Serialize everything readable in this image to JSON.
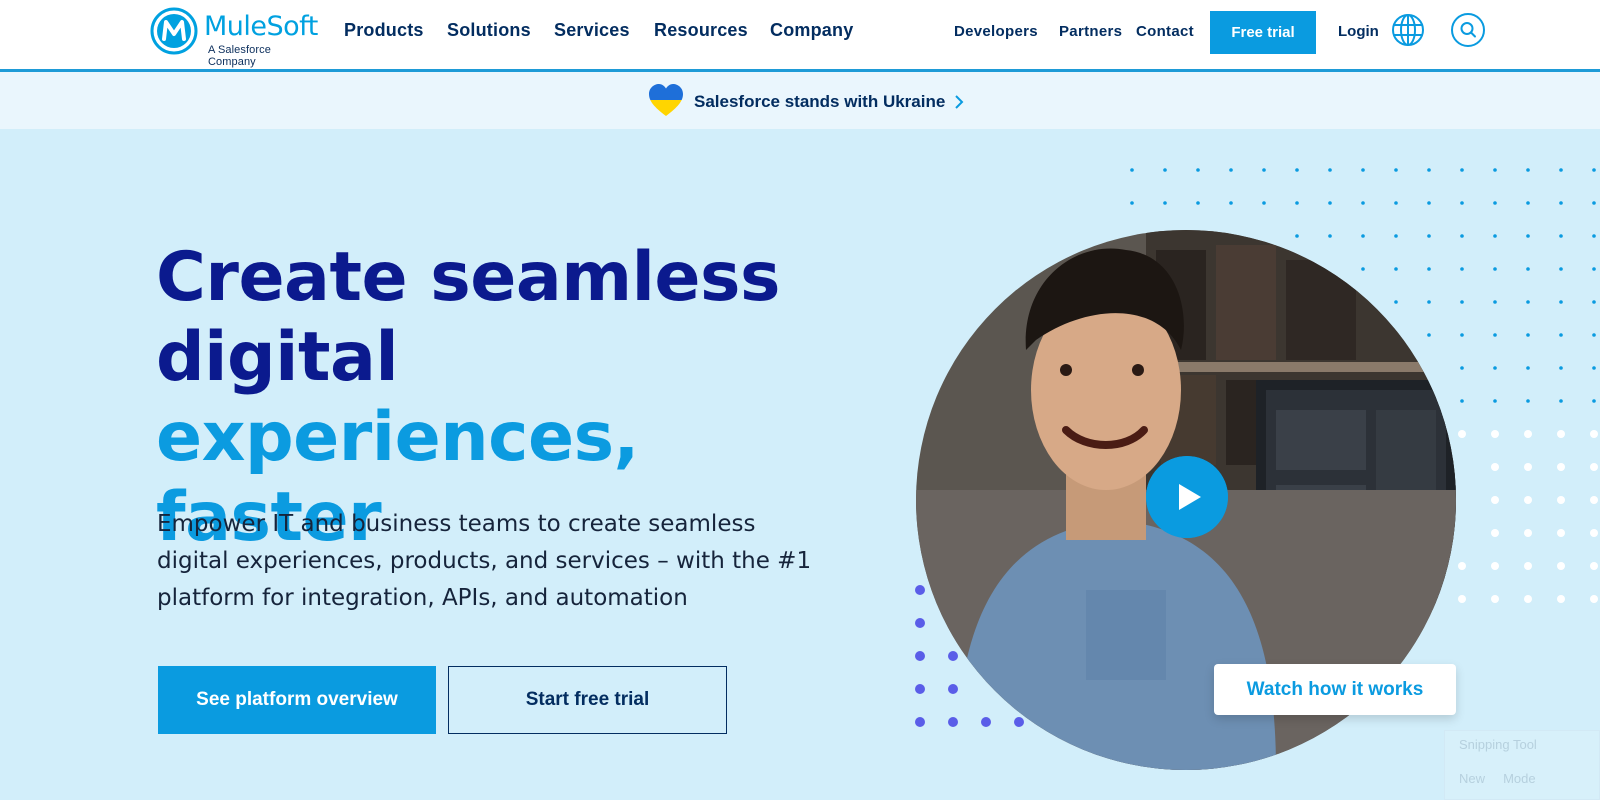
{
  "header": {
    "logo": {
      "name": "MuleSoft",
      "subtitle": "A Salesforce Company"
    },
    "nav_main": [
      "Products",
      "Solutions",
      "Services",
      "Resources",
      "Company"
    ],
    "nav_secondary": [
      "Developers",
      "Partners",
      "Contact"
    ],
    "free_trial_label": "Free trial",
    "login_label": "Login",
    "icons": [
      "globe-icon",
      "search-icon"
    ]
  },
  "banner": {
    "text": "Salesforce stands with Ukraine",
    "icon": "ukraine-heart-icon",
    "heart_colors": [
      "#1e6fd9",
      "#ffd500"
    ]
  },
  "hero": {
    "headline_part1": "Create seamless",
    "headline_part2": "digital ",
    "headline_accent": "experiences,",
    "headline_part3": "faster",
    "subtext": "Empower IT and business teams to create seamless digital experiences, products, and services – with the #1 platform for integration, APIs, and automation",
    "primary_button": "See platform overview",
    "secondary_button": "Start free trial"
  },
  "video": {
    "watch_label": "Watch how it works",
    "play_icon": "play-icon"
  },
  "overlay": {
    "title": "Snipping Tool",
    "new_label": "New",
    "mode_label": "Mode"
  },
  "colors": {
    "brand_blue": "#0a9be0",
    "navy": "#032d60",
    "headline_navy": "#0b1a8e",
    "hero_bg": "#d2eefa",
    "banner_bg": "#eaf6fd",
    "dot_purple": "#5a5de8"
  }
}
